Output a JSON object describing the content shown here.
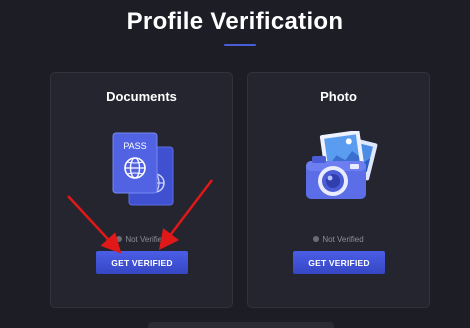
{
  "page": {
    "title": "Profile Verification"
  },
  "cards": [
    {
      "title": "Documents",
      "icon": "passport-icon",
      "status": "Not Verified",
      "button_label": "GET VERIFIED"
    },
    {
      "title": "Photo",
      "icon": "camera-icon",
      "status": "Not Verified",
      "button_label": "GET VERIFIED"
    }
  ],
  "colors": {
    "background": "#1c1d25",
    "card": "#24252e",
    "accent": "#4a5ee6",
    "annotation_arrow": "#e01818"
  }
}
